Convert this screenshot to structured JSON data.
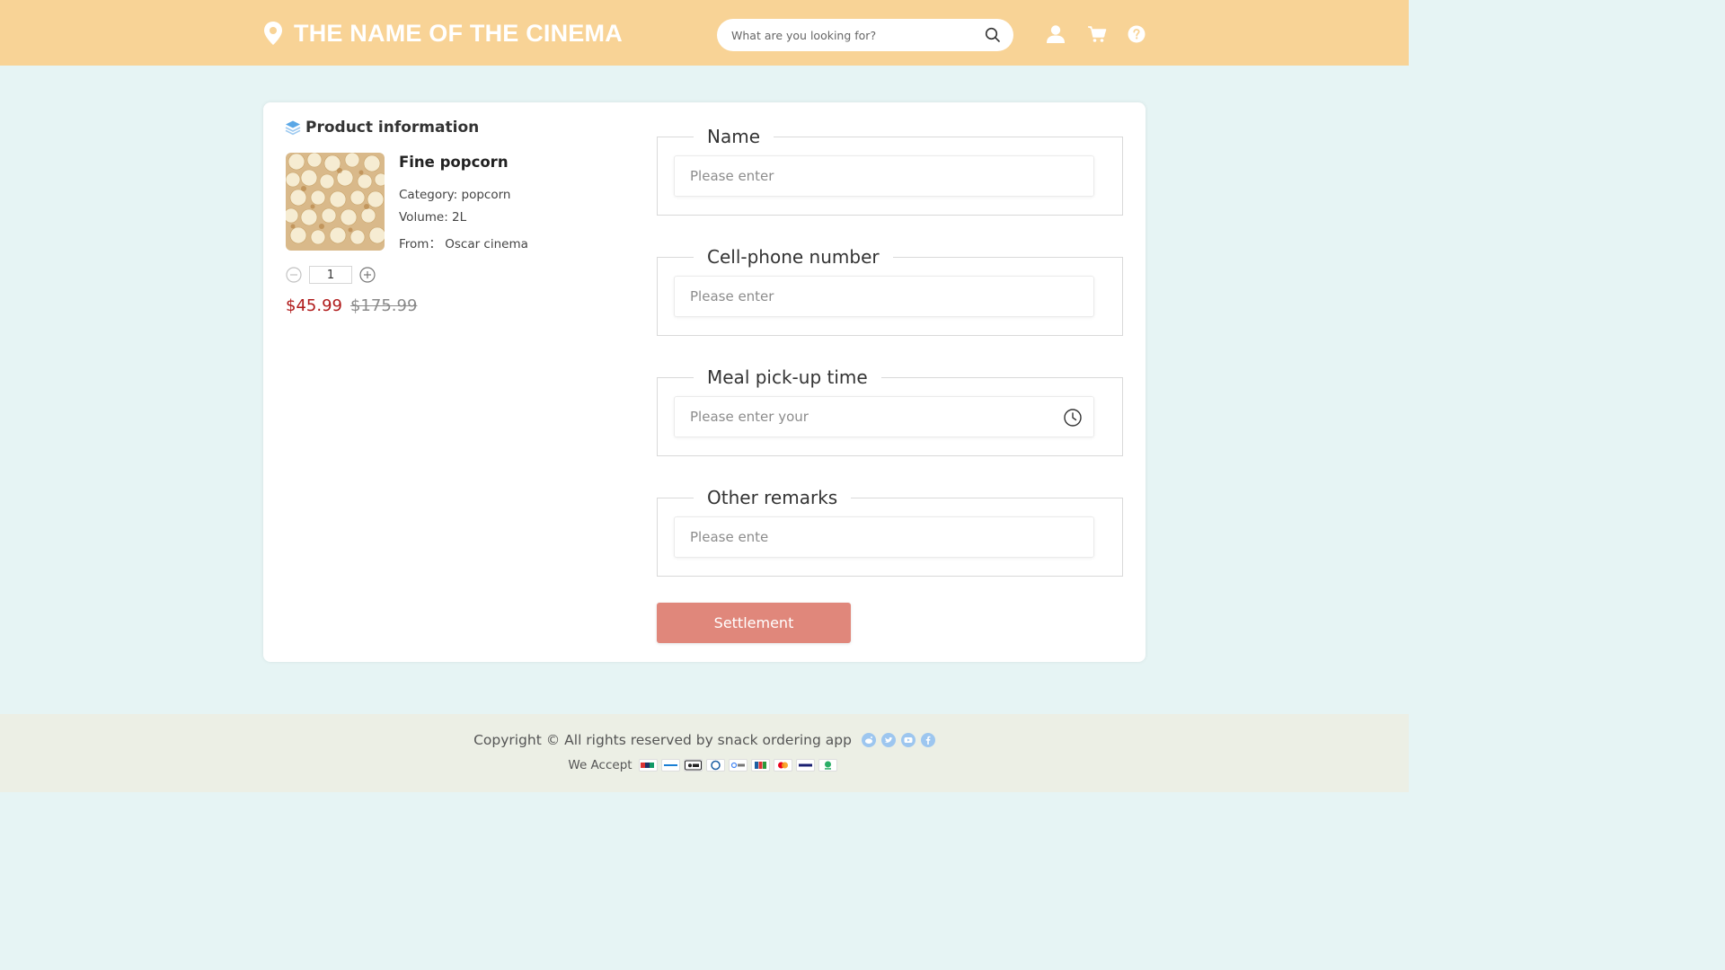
{
  "header": {
    "title": "THE NAME OF THE CINEMA",
    "search_placeholder": "What are you looking for?",
    "icons": [
      "location-pin-icon",
      "search-icon",
      "user-icon",
      "cart-icon",
      "help-icon"
    ]
  },
  "product": {
    "section_title": "Product information",
    "name": "Fine popcorn",
    "category": "Category: popcorn",
    "volume": "Volume: 2L",
    "from": "From： Oscar cinema",
    "quantity": "1",
    "price": "$45.99",
    "original_price": "$175.99"
  },
  "form": {
    "name": {
      "legend": "Name",
      "placeholder": "Please enter"
    },
    "phone": {
      "legend": "Cell-phone number",
      "placeholder": "Please enter"
    },
    "pickup": {
      "legend": "Meal pick-up time",
      "placeholder": "Please enter your"
    },
    "remarks": {
      "legend": "Other remarks",
      "placeholder": "Please ente"
    },
    "submit_label": "Settlement"
  },
  "footer": {
    "copyright": "Copyright © All rights reserved by snack ordering app",
    "accept_label": "We Accept",
    "social_icons": [
      "reddit-icon",
      "twitter-icon",
      "youtube-icon",
      "facebook-icon"
    ],
    "payment_icons": [
      "unionpay-icon",
      "alipay-icon",
      "apple-pay-icon",
      "diners-icon",
      "google-pay-icon",
      "jcb-icon",
      "mastercard-icon",
      "visa-icon",
      "wechat-pay-icon"
    ]
  },
  "colors": {
    "header_bg": "#f8d396",
    "page_bg": "#e6f4f4",
    "price": "#b01b1b",
    "button": "#e0877b",
    "footer_bg": "#ecefe5"
  }
}
